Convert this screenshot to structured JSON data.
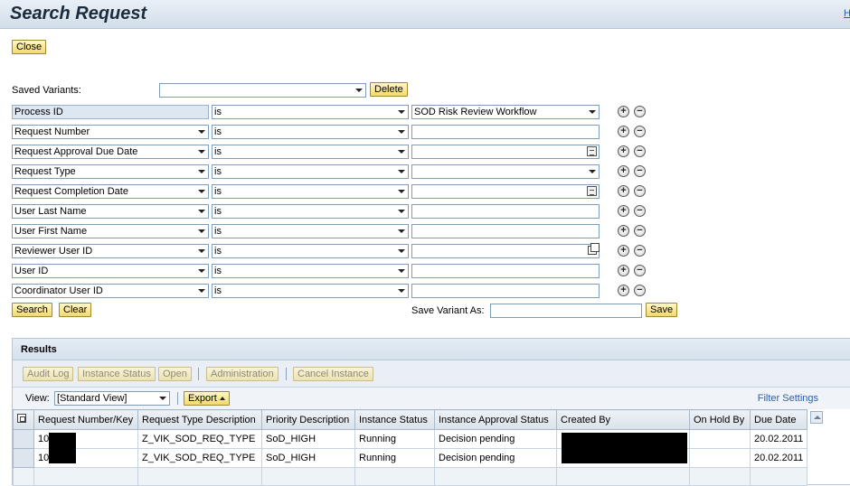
{
  "header": {
    "title": "Search Request",
    "help_link": "H"
  },
  "actions": {
    "close_label": "Close"
  },
  "variants": {
    "label": "Saved Variants:",
    "value": "",
    "delete_label": "Delete"
  },
  "criteria": [
    {
      "field": "Process ID",
      "operator": "is",
      "value": "SOD Risk Review Workflow",
      "value_type": "dropdown",
      "field_readonly": true
    },
    {
      "field": "Request Number",
      "operator": "is",
      "value": "",
      "value_type": "text"
    },
    {
      "field": "Request Approval Due Date",
      "operator": "is",
      "value": "",
      "value_type": "date"
    },
    {
      "field": "Request Type",
      "operator": "is",
      "value": "",
      "value_type": "dropdown"
    },
    {
      "field": "Request Completion Date",
      "operator": "is",
      "value": "",
      "value_type": "date"
    },
    {
      "field": "User Last Name",
      "operator": "is",
      "value": "",
      "value_type": "text"
    },
    {
      "field": "User First Name",
      "operator": "is",
      "value": "",
      "value_type": "text"
    },
    {
      "field": "Reviewer User ID",
      "operator": "is",
      "value": "",
      "value_type": "lookup"
    },
    {
      "field": "User ID",
      "operator": "is",
      "value": "",
      "value_type": "text"
    },
    {
      "field": "Coordinator User ID",
      "operator": "is",
      "value": "",
      "value_type": "text"
    }
  ],
  "search_bar": {
    "search_label": "Search",
    "clear_label": "Clear",
    "save_variant_label": "Save Variant As:",
    "save_variant_value": "",
    "save_label": "Save"
  },
  "results": {
    "title": "Results",
    "toolbar": {
      "audit_log": "Audit Log",
      "instance_status": "Instance Status",
      "open": "Open",
      "administration": "Administration",
      "cancel_instance": "Cancel Instance"
    },
    "view_label": "View:",
    "view_value": "[Standard View]",
    "export_label": "Export",
    "filter_settings": "Filter Settings",
    "columns": [
      "Request Number/Key",
      "Request Type Description",
      "Priority Description",
      "Instance Status",
      "Instance Approval Status",
      "Created By",
      "On Hold By",
      "Due Date"
    ],
    "rows": [
      [
        "10",
        "Z_VIK_SOD_REQ_TYPE",
        "SoD_HIGH",
        "Running",
        "Decision pending",
        "",
        "",
        "20.02.2011"
      ],
      [
        "10",
        "Z_VIK_SOD_REQ_TYPE",
        "SoD_HIGH",
        "Running",
        "Decision pending",
        "",
        "",
        "20.02.2011"
      ]
    ]
  },
  "icons": {
    "add": "plus-circle-icon",
    "remove": "minus-circle-icon",
    "calendar": "calendar-icon",
    "lookup": "value-help-icon",
    "columns": "column-settings-icon"
  }
}
